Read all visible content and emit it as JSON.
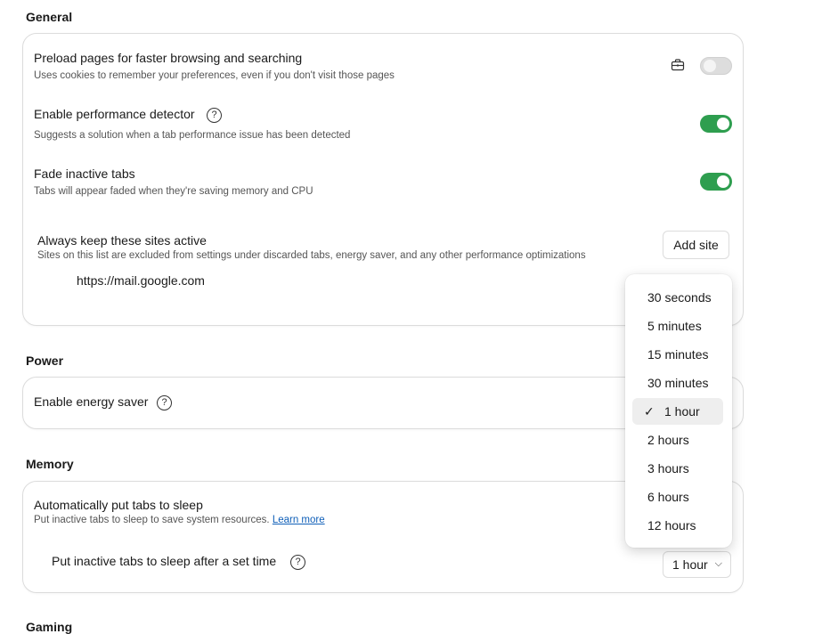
{
  "general": {
    "title": "General",
    "preload": {
      "title": "Preload pages for faster browsing and searching",
      "desc": "Uses cookies to remember your preferences, even if you don't visit those pages"
    },
    "detector": {
      "title": "Enable performance detector",
      "desc": "Suggests a solution when a tab performance issue has been detected"
    },
    "fade": {
      "title": "Fade inactive tabs",
      "desc": "Tabs will appear faded when they're saving memory and CPU"
    },
    "keep_active": {
      "title": "Always keep these sites active",
      "desc": "Sites on this list are excluded from settings under discarded tabs, energy saver, and any other performance optimizations",
      "add_label": "Add site",
      "sites": [
        "https://mail.google.com"
      ]
    }
  },
  "power": {
    "title": "Power",
    "energy_saver": {
      "title": "Enable energy saver"
    }
  },
  "memory": {
    "title": "Memory",
    "sleep": {
      "title": "Automatically put tabs to sleep",
      "desc": "Put inactive tabs to sleep to save system resources.",
      "learn_more": "Learn more"
    },
    "sleep_after": {
      "title": "Put inactive tabs to sleep after a set time",
      "selected": "1 hour"
    }
  },
  "gaming": {
    "title": "Gaming"
  },
  "help_symbol": "?",
  "check_symbol": "✓",
  "chevron_symbol": "⌵",
  "dropdown": {
    "options": [
      "30 seconds",
      "5 minutes",
      "15 minutes",
      "30 minutes",
      "1 hour",
      "2 hours",
      "3 hours",
      "6 hours",
      "12 hours"
    ],
    "selected_index": 4
  },
  "colors": {
    "toggle_on": "#2e9e4f",
    "link": "#0f5fb8"
  }
}
